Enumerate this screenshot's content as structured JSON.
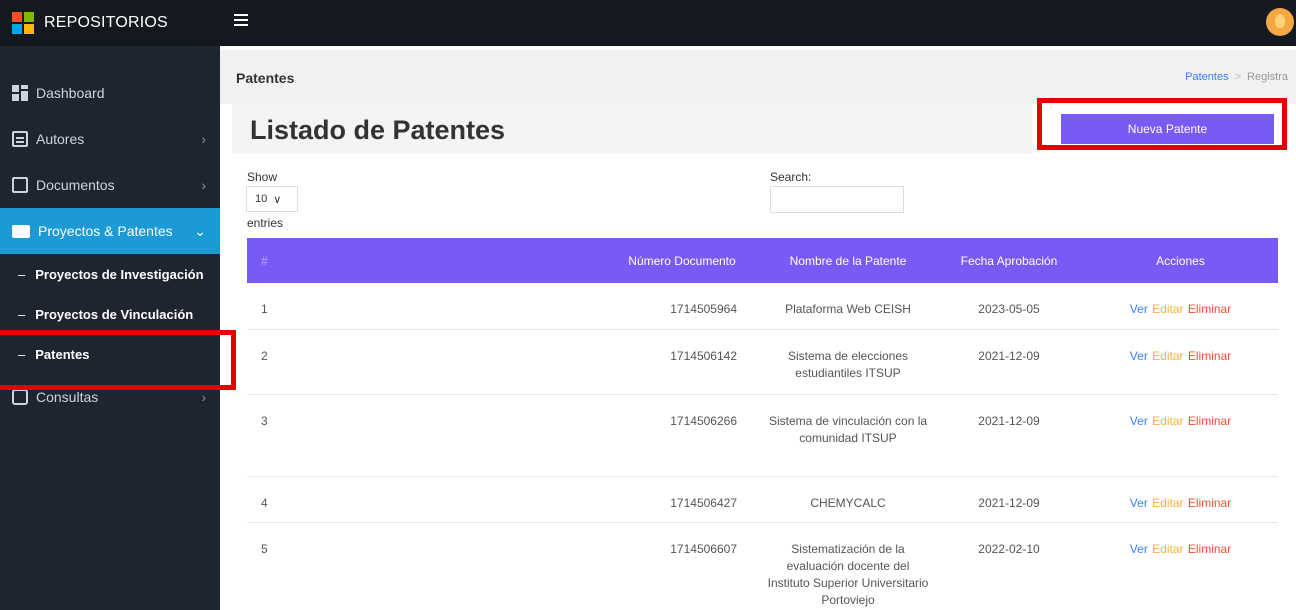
{
  "brand": {
    "title": "REPOSITORIOS"
  },
  "sidebar": {
    "items": [
      {
        "label": "Dashboard",
        "icon": "dashboard-icon"
      },
      {
        "label": "Autores",
        "icon": "list-icon"
      },
      {
        "label": "Documentos",
        "icon": "document-icon"
      },
      {
        "label": "Proyectos & Patentes",
        "icon": "folder-icon",
        "active": true
      },
      {
        "label": "Consultas",
        "icon": "search-icon"
      }
    ],
    "subitems": [
      {
        "label": "Proyectos de Investigación"
      },
      {
        "label": "Proyectos de Vinculación"
      },
      {
        "label": "Patentes"
      }
    ],
    "sub_dash": "–"
  },
  "header": {
    "title": "Patentes",
    "breadcrumb": {
      "link": "Patentes",
      "separator": ">",
      "current": "Registra"
    }
  },
  "main": {
    "title": "Listado de Patentes",
    "new_button": "Nueva Patente",
    "show_label": "Show",
    "show_value": "10",
    "entries_label": "entries",
    "search_label": "Search:"
  },
  "table": {
    "headers": [
      "#",
      "Número Documento",
      "Nombre de la Patente",
      "Fecha Aprobación",
      "Acciones"
    ],
    "rows": [
      {
        "num": "1",
        "doc": "1714505964",
        "name": "Plataforma Web CEISH",
        "date": "2023-05-05"
      },
      {
        "num": "2",
        "doc": "1714506142",
        "name": "Sistema de elecciones estudiantiles ITSUP",
        "date": "2021-12-09"
      },
      {
        "num": "3",
        "doc": "1714506266",
        "name": "Sistema de vinculación con la comunidad ITSUP",
        "date": "2021-12-09"
      },
      {
        "num": "4",
        "doc": "1714506427",
        "name": "CHEMYCALC",
        "date": "2021-12-09"
      },
      {
        "num": "5",
        "doc": "1714506607",
        "name": "Sistematización de la evaluación docente del Instituto Superior Universitario Portoviejo",
        "date": "2022-02-10"
      }
    ],
    "actions": {
      "view": "Ver",
      "edit": "Editar",
      "delete": "Eliminar"
    }
  },
  "colors": {
    "accent": "#7a5af5",
    "sidebar_active": "#1b9ad6",
    "highlight": "#e60000"
  }
}
